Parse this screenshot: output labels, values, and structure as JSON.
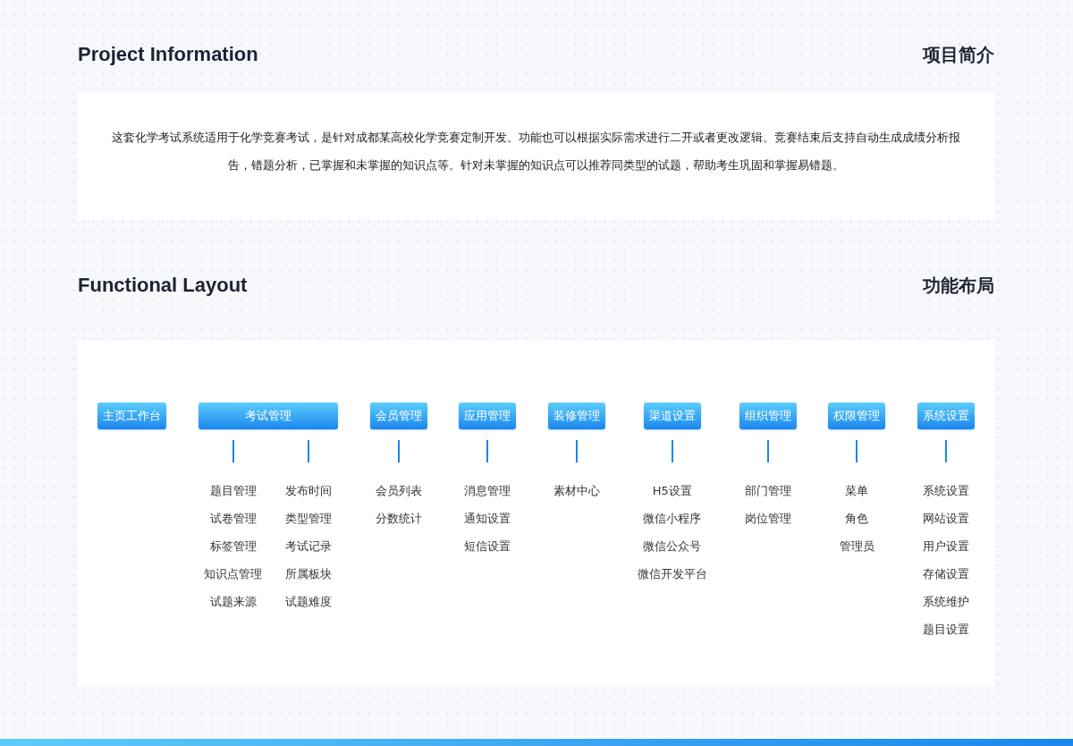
{
  "sections": [
    {
      "title_en": "Project Information",
      "title_zh": "项目简介",
      "kind": "text",
      "paragraph": "这套化学考试系统适用于化学竞赛考试，是针对成都某高校化学竞赛定制开发。功能也可以根据实际需求进行二开或者更改逻辑。竞赛结束后支持自动生成成绩分析报告，错题分析，已掌握和未掌握的知识点等。针对未掌握的知识点可以推荐同类型的试题，帮助考生巩固和掌握易错题。"
    },
    {
      "title_en": "Functional Layout",
      "title_zh": "功能布局",
      "kind": "modules",
      "modules": [
        {
          "title": "主页工作台"
        },
        {
          "title": "考试管理",
          "columns": [
            [
              "题目管理",
              "试卷管理",
              "标签管理",
              "知识点管理",
              "试题来源"
            ],
            [
              "发布时间",
              "类型管理",
              "考试记录",
              "所属板块",
              "试题难度"
            ]
          ]
        },
        {
          "title": "会员管理",
          "columns": [
            [
              "会员列表",
              "分数统计"
            ]
          ]
        },
        {
          "title": "应用管理",
          "columns": [
            [
              "消息管理",
              "通知设置",
              "短信设置"
            ]
          ]
        },
        {
          "title": "装修管理",
          "columns": [
            [
              "素材中心"
            ]
          ]
        },
        {
          "title": "渠道设置",
          "columns": [
            [
              "H5设置",
              "微信小程序",
              "微信公众号",
              "微信开发平台"
            ]
          ]
        },
        {
          "title": "组织管理",
          "columns": [
            [
              "部门管理",
              "岗位管理"
            ]
          ]
        },
        {
          "title": "权限管理",
          "columns": [
            [
              "菜单",
              "角色",
              "管理员"
            ]
          ]
        },
        {
          "title": "系统设置",
          "columns": [
            [
              "系统设置",
              "网站设置",
              "用户设置",
              "存储设置",
              "系统维护",
              "题目设置"
            ]
          ]
        }
      ]
    }
  ]
}
